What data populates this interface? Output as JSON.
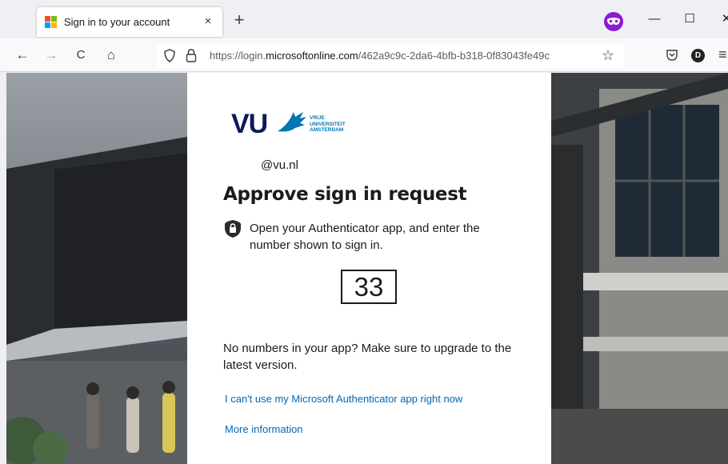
{
  "browser": {
    "tab": {
      "title": "Sign in to your account",
      "close_label": "×"
    },
    "new_tab_label": "+",
    "window_controls": {
      "minimize": "—",
      "maximize": "☐",
      "close": "✕"
    },
    "nav": {
      "back": "←",
      "forward": "→",
      "reload": "C",
      "home": "⌂"
    },
    "url": {
      "prefix": "https://login.",
      "domain": "microsoftonline.com",
      "path": "/462a9c9c-2da6-4bfb-b318-0f83043fe49c"
    },
    "star": "☆",
    "profile_initial": "D",
    "menu": "≡"
  },
  "signin": {
    "logo": {
      "mark": "VU",
      "text_lines": [
        "VRIJE",
        "UNIVERSITEIT",
        "AMSTERDAM"
      ]
    },
    "email": "@vu.nl",
    "heading": "Approve sign in request",
    "instruction": "Open your Authenticator app, and enter the number shown to sign in.",
    "number": "33",
    "upgrade_notice": "No numbers in your app? Make sure to upgrade to the latest version.",
    "links": {
      "cant_use": "I can't use my Microsoft Authenticator app right now",
      "more_info": "More information"
    }
  },
  "colors": {
    "link": "#0067b8",
    "vu_navy": "#0a1a5c",
    "vu_blue": "#0077b3",
    "ext_purple": "#8c1bd4"
  }
}
